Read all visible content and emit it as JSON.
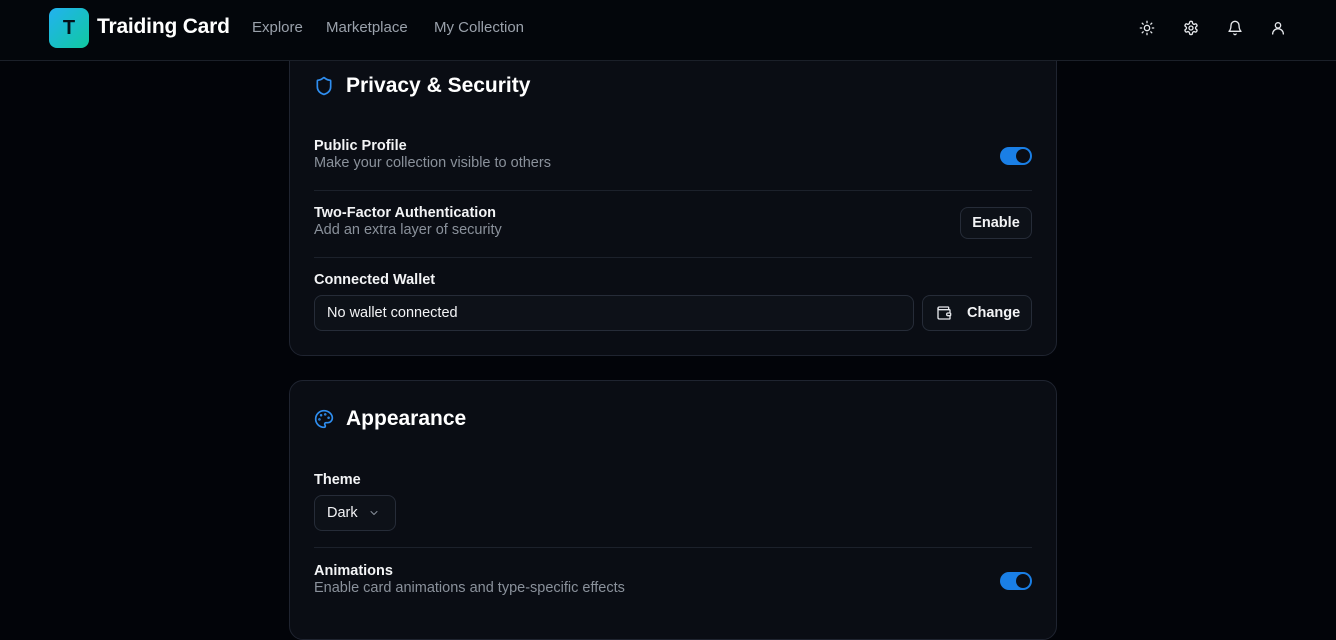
{
  "app": {
    "logo_letter": "T",
    "brand_name": "Traiding Card"
  },
  "nav": {
    "links": [
      "Explore",
      "Marketplace",
      "My Collection"
    ],
    "icons": [
      "sun-icon",
      "settings-gear-icon",
      "bell-icon",
      "user-icon"
    ]
  },
  "privacy": {
    "title": "Privacy & Security",
    "icon": "shield-icon",
    "public_profile": {
      "label": "Public Profile",
      "description": "Make your collection visible to others",
      "enabled": true
    },
    "two_factor": {
      "label": "Two-Factor Authentication",
      "description": "Add an extra layer of security",
      "button": "Enable"
    },
    "wallet": {
      "label": "Connected Wallet",
      "value": "No wallet connected",
      "button": "Change",
      "button_icon": "wallet-icon"
    }
  },
  "appearance": {
    "title": "Appearance",
    "icon": "palette-icon",
    "theme": {
      "label": "Theme",
      "selected": "Dark"
    },
    "animations": {
      "label": "Animations",
      "description": "Enable card animations and type-specific effects",
      "enabled": true
    }
  },
  "colors": {
    "accent": "#1a7fe6",
    "background": "#020409",
    "card": "#0a0d14"
  }
}
